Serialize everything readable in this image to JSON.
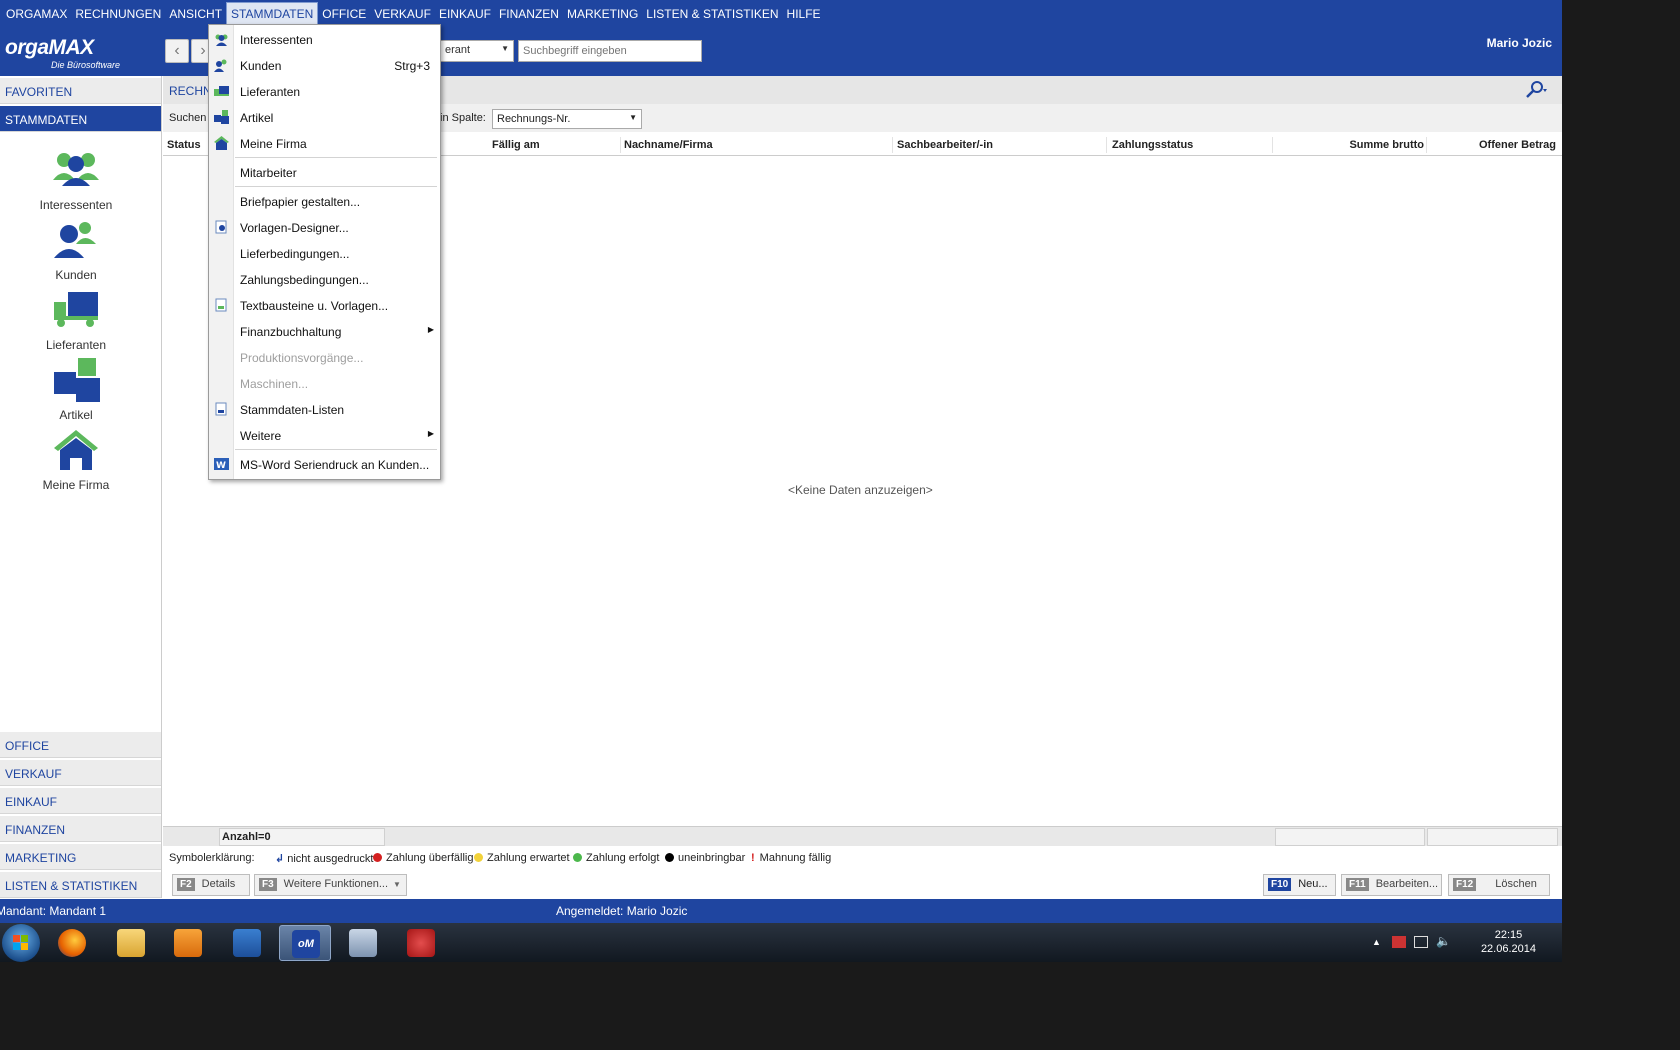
{
  "menubar": {
    "items": [
      "ORGAMAX",
      "RECHNUNGEN",
      "ANSICHT",
      "STAMMDATEN",
      "OFFICE",
      "VERKAUF",
      "EINKAUF",
      "FINANZEN",
      "MARKETING",
      "LISTEN & STATISTIKEN",
      "HILFE"
    ],
    "active": "STAMMDATEN"
  },
  "header": {
    "brand": "orgaMAX",
    "tagline": "Die Bürosoftware",
    "scope_value": "erant",
    "search_placeholder": "Suchbegriff eingeben",
    "user": "Mario Jozic"
  },
  "sidebar": {
    "favoriten": "FAVORITEN",
    "stammdaten": "STAMMDATEN",
    "items": [
      {
        "label": "Interessenten",
        "icon": "people-icon"
      },
      {
        "label": "Kunden",
        "icon": "customer-icon"
      },
      {
        "label": "Lieferanten",
        "icon": "truck-icon"
      },
      {
        "label": "Artikel",
        "icon": "blocks-icon"
      },
      {
        "label": "Meine Firma",
        "icon": "house-icon"
      }
    ],
    "bottom": [
      "OFFICE",
      "VERKAUF",
      "EINKAUF",
      "FINANZEN",
      "MARKETING",
      "LISTEN & STATISTIKEN"
    ]
  },
  "main": {
    "breadcrumb": "RECHN",
    "search_label": "Suchen n",
    "column_label": "in Spalte:",
    "column_value": "Rechnungs-Nr.",
    "columns": [
      "Status",
      "Fällig am",
      "Nachname/Firma",
      "Sachbearbeiter/-in",
      "Zahlungsstatus",
      "Summe brutto",
      "Offener Betrag"
    ],
    "nodata": "<Keine Daten anzuzeigen>",
    "count": "Anzahl=0"
  },
  "legend": {
    "title": "Symbolerklärung:",
    "items": [
      {
        "label": "nicht ausgedruckt",
        "color": "#1f45a0"
      },
      {
        "label": "Zahlung überfällig",
        "color": "#d42020"
      },
      {
        "label": "Zahlung erwartet",
        "color": "#f2d23a"
      },
      {
        "label": "Zahlung erfolgt",
        "color": "#4cb84c"
      },
      {
        "label": "uneinbringbar",
        "color": "#000000"
      },
      {
        "label": "Mahnung fällig",
        "color": "#d42020"
      }
    ]
  },
  "actions": {
    "details": {
      "key": "F2",
      "label": "Details"
    },
    "weitere": {
      "key": "F3",
      "label": "Weitere Funktionen..."
    },
    "neu": {
      "key": "F10",
      "label": "Neu..."
    },
    "bearbeiten": {
      "key": "F11",
      "label": "Bearbeiten..."
    },
    "loeschen": {
      "key": "F12",
      "label": "Löschen"
    }
  },
  "statusbar": {
    "mandant": "Mandant: Mandant 1",
    "angemeldet": "Angemeldet: Mario Jozic"
  },
  "taskbar": {
    "time": "22:15",
    "date": "22.06.2014"
  },
  "dropdown": {
    "items": [
      {
        "label": "Interessenten",
        "shortcut": "",
        "icon": "people-icon"
      },
      {
        "label": "Kunden",
        "shortcut": "Strg+3",
        "icon": "customer-icon"
      },
      {
        "label": "Lieferanten",
        "shortcut": "",
        "icon": "truck-icon"
      },
      {
        "label": "Artikel",
        "shortcut": "",
        "icon": "blocks-icon"
      },
      {
        "label": "Meine Firma",
        "shortcut": "",
        "icon": "house-icon"
      },
      {
        "label": "Mitarbeiter"
      },
      {
        "label": "Briefpapier gestalten..."
      },
      {
        "label": "Vorlagen-Designer..."
      },
      {
        "label": "Lieferbedingungen..."
      },
      {
        "label": "Zahlungsbedingungen..."
      },
      {
        "label": "Textbausteine u. Vorlagen..."
      },
      {
        "label": "Finanzbuchhaltung"
      },
      {
        "label": "Produktionsvorgänge..."
      },
      {
        "label": "Maschinen..."
      },
      {
        "label": "Stammdaten-Listen"
      },
      {
        "label": "Weitere"
      },
      {
        "label": "MS-Word Seriendruck an Kunden..."
      }
    ]
  },
  "colors": {
    "brand_blue": "#1f45a0",
    "accent_green": "#5cb85c"
  }
}
